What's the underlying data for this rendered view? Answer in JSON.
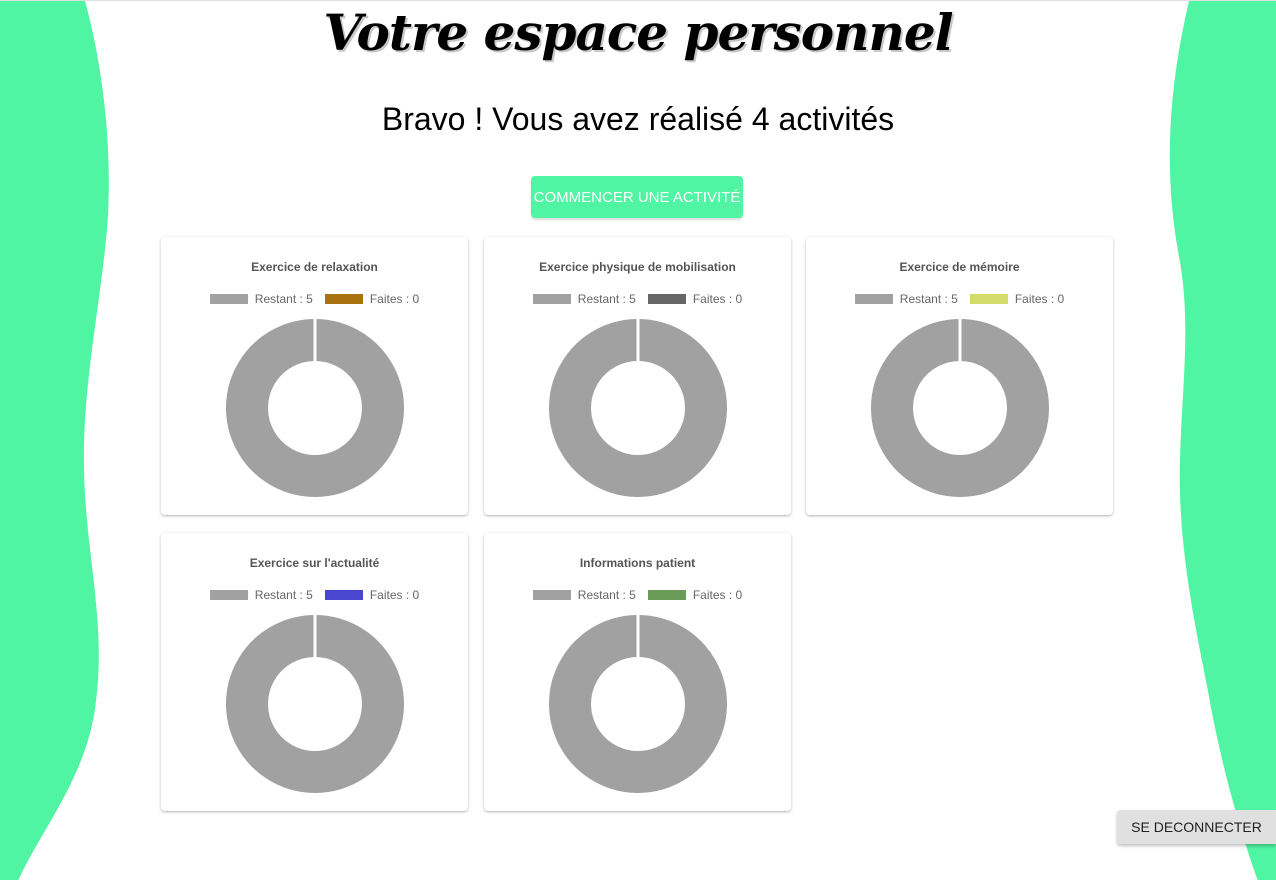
{
  "header": {
    "title": "Votre espace personnel",
    "subtitle": "Bravo ! Vous avez réalisé 4 activités"
  },
  "actions": {
    "start_label": "COMMENCER UNE ACTIVITÉ",
    "logout_label": "SE DECONNECTER"
  },
  "colors": {
    "accent": "#4ff5a2",
    "remaining": "#a1a1a1"
  },
  "chart_data": [
    {
      "type": "pie",
      "title": "Exercice de relaxation",
      "labels": [
        "Restant",
        "Faites"
      ],
      "values": [
        5,
        0
      ],
      "legend": [
        "Restant : 5",
        "Faites : 0"
      ],
      "colors": [
        "#a1a1a1",
        "#a8720f"
      ],
      "donut": true
    },
    {
      "type": "pie",
      "title": "Exercice physique de mobilisation",
      "labels": [
        "Restant",
        "Faites"
      ],
      "values": [
        5,
        0
      ],
      "legend": [
        "Restant : 5",
        "Faites : 0"
      ],
      "colors": [
        "#a1a1a1",
        "#666666"
      ],
      "donut": true
    },
    {
      "type": "pie",
      "title": "Exercice de mémoire",
      "labels": [
        "Restant",
        "Faites"
      ],
      "values": [
        5,
        0
      ],
      "legend": [
        "Restant : 5",
        "Faites : 0"
      ],
      "colors": [
        "#a1a1a1",
        "#d3dc6a"
      ],
      "donut": true
    },
    {
      "type": "pie",
      "title": "Exercice sur l'actualité",
      "labels": [
        "Restant",
        "Faites"
      ],
      "values": [
        5,
        0
      ],
      "legend": [
        "Restant : 5",
        "Faites : 0"
      ],
      "colors": [
        "#a1a1a1",
        "#4a46d0"
      ],
      "donut": true
    },
    {
      "type": "pie",
      "title": "Informations patient",
      "labels": [
        "Restant",
        "Faites"
      ],
      "values": [
        5,
        0
      ],
      "legend": [
        "Restant : 5",
        "Faites : 0"
      ],
      "colors": [
        "#a1a1a1",
        "#6a9c58"
      ],
      "donut": true
    }
  ]
}
